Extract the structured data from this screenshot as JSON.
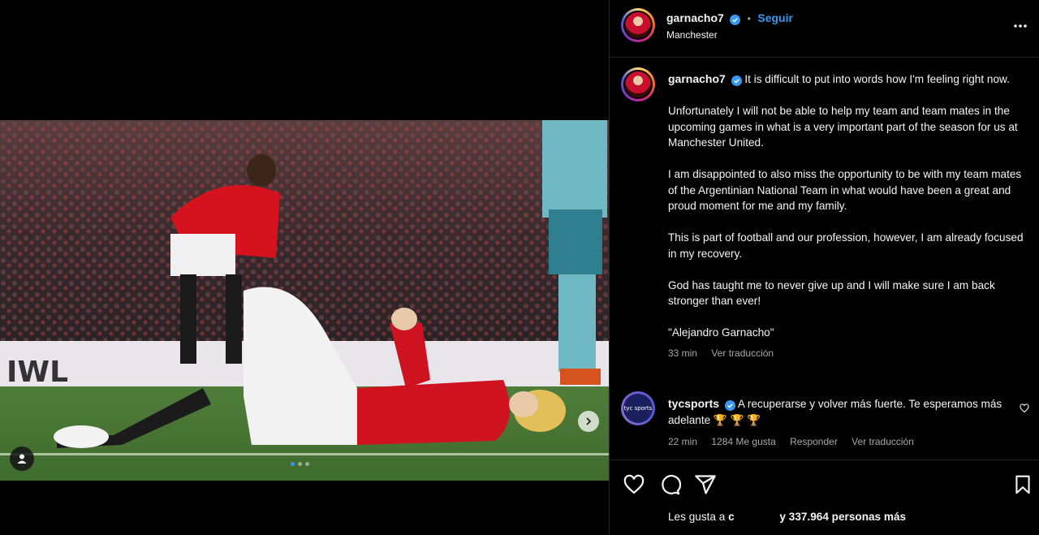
{
  "post": {
    "username": "garnacho7",
    "follow_label": "Seguir",
    "separator": "•",
    "location": "Manchester",
    "caption_first": "It is difficult to put into words how I'm feeling right now.",
    "caption_paragraphs": [
      "Unfortunately I will not be able to help my team and team mates in the upcoming games in what is a very important part of the season for us at Manchester United.",
      "I am disappointed to also miss the opportunity to be with my team mates of the Argentinian National Team in what would have been a great and proud moment for me and my family.",
      "This is part of football and our profession, however, I am already focused in my recovery.",
      "God has taught me to never give up and I will make sure I am back stronger than ever!",
      "\"Alejandro Garnacho\""
    ],
    "time": "33 min",
    "translate": "Ver traducción"
  },
  "comment": {
    "username": "tycsports",
    "avatar_text": "tyc sports",
    "text": "A recuperarse y volver más fuerte. Te esperamos más adelante 🏆 🏆 🏆",
    "time": "22 min",
    "likes": "1284 Me gusta",
    "reply": "Responder",
    "translate": "Ver traducción"
  },
  "likes_bar": {
    "prefix": "Les gusta a",
    "user": "c",
    "suffix": "y 337.964 personas más"
  },
  "carousel": {
    "total": 3,
    "active": 0
  },
  "icons": [
    "verified-icon",
    "more-icon",
    "chevron-right-icon",
    "user-tag-icon",
    "heart-icon",
    "comment-icon",
    "share-icon",
    "bookmark-icon"
  ],
  "colors": {
    "accent": "#3897f0",
    "background": "#000000",
    "muted": "#a8a8a8"
  }
}
